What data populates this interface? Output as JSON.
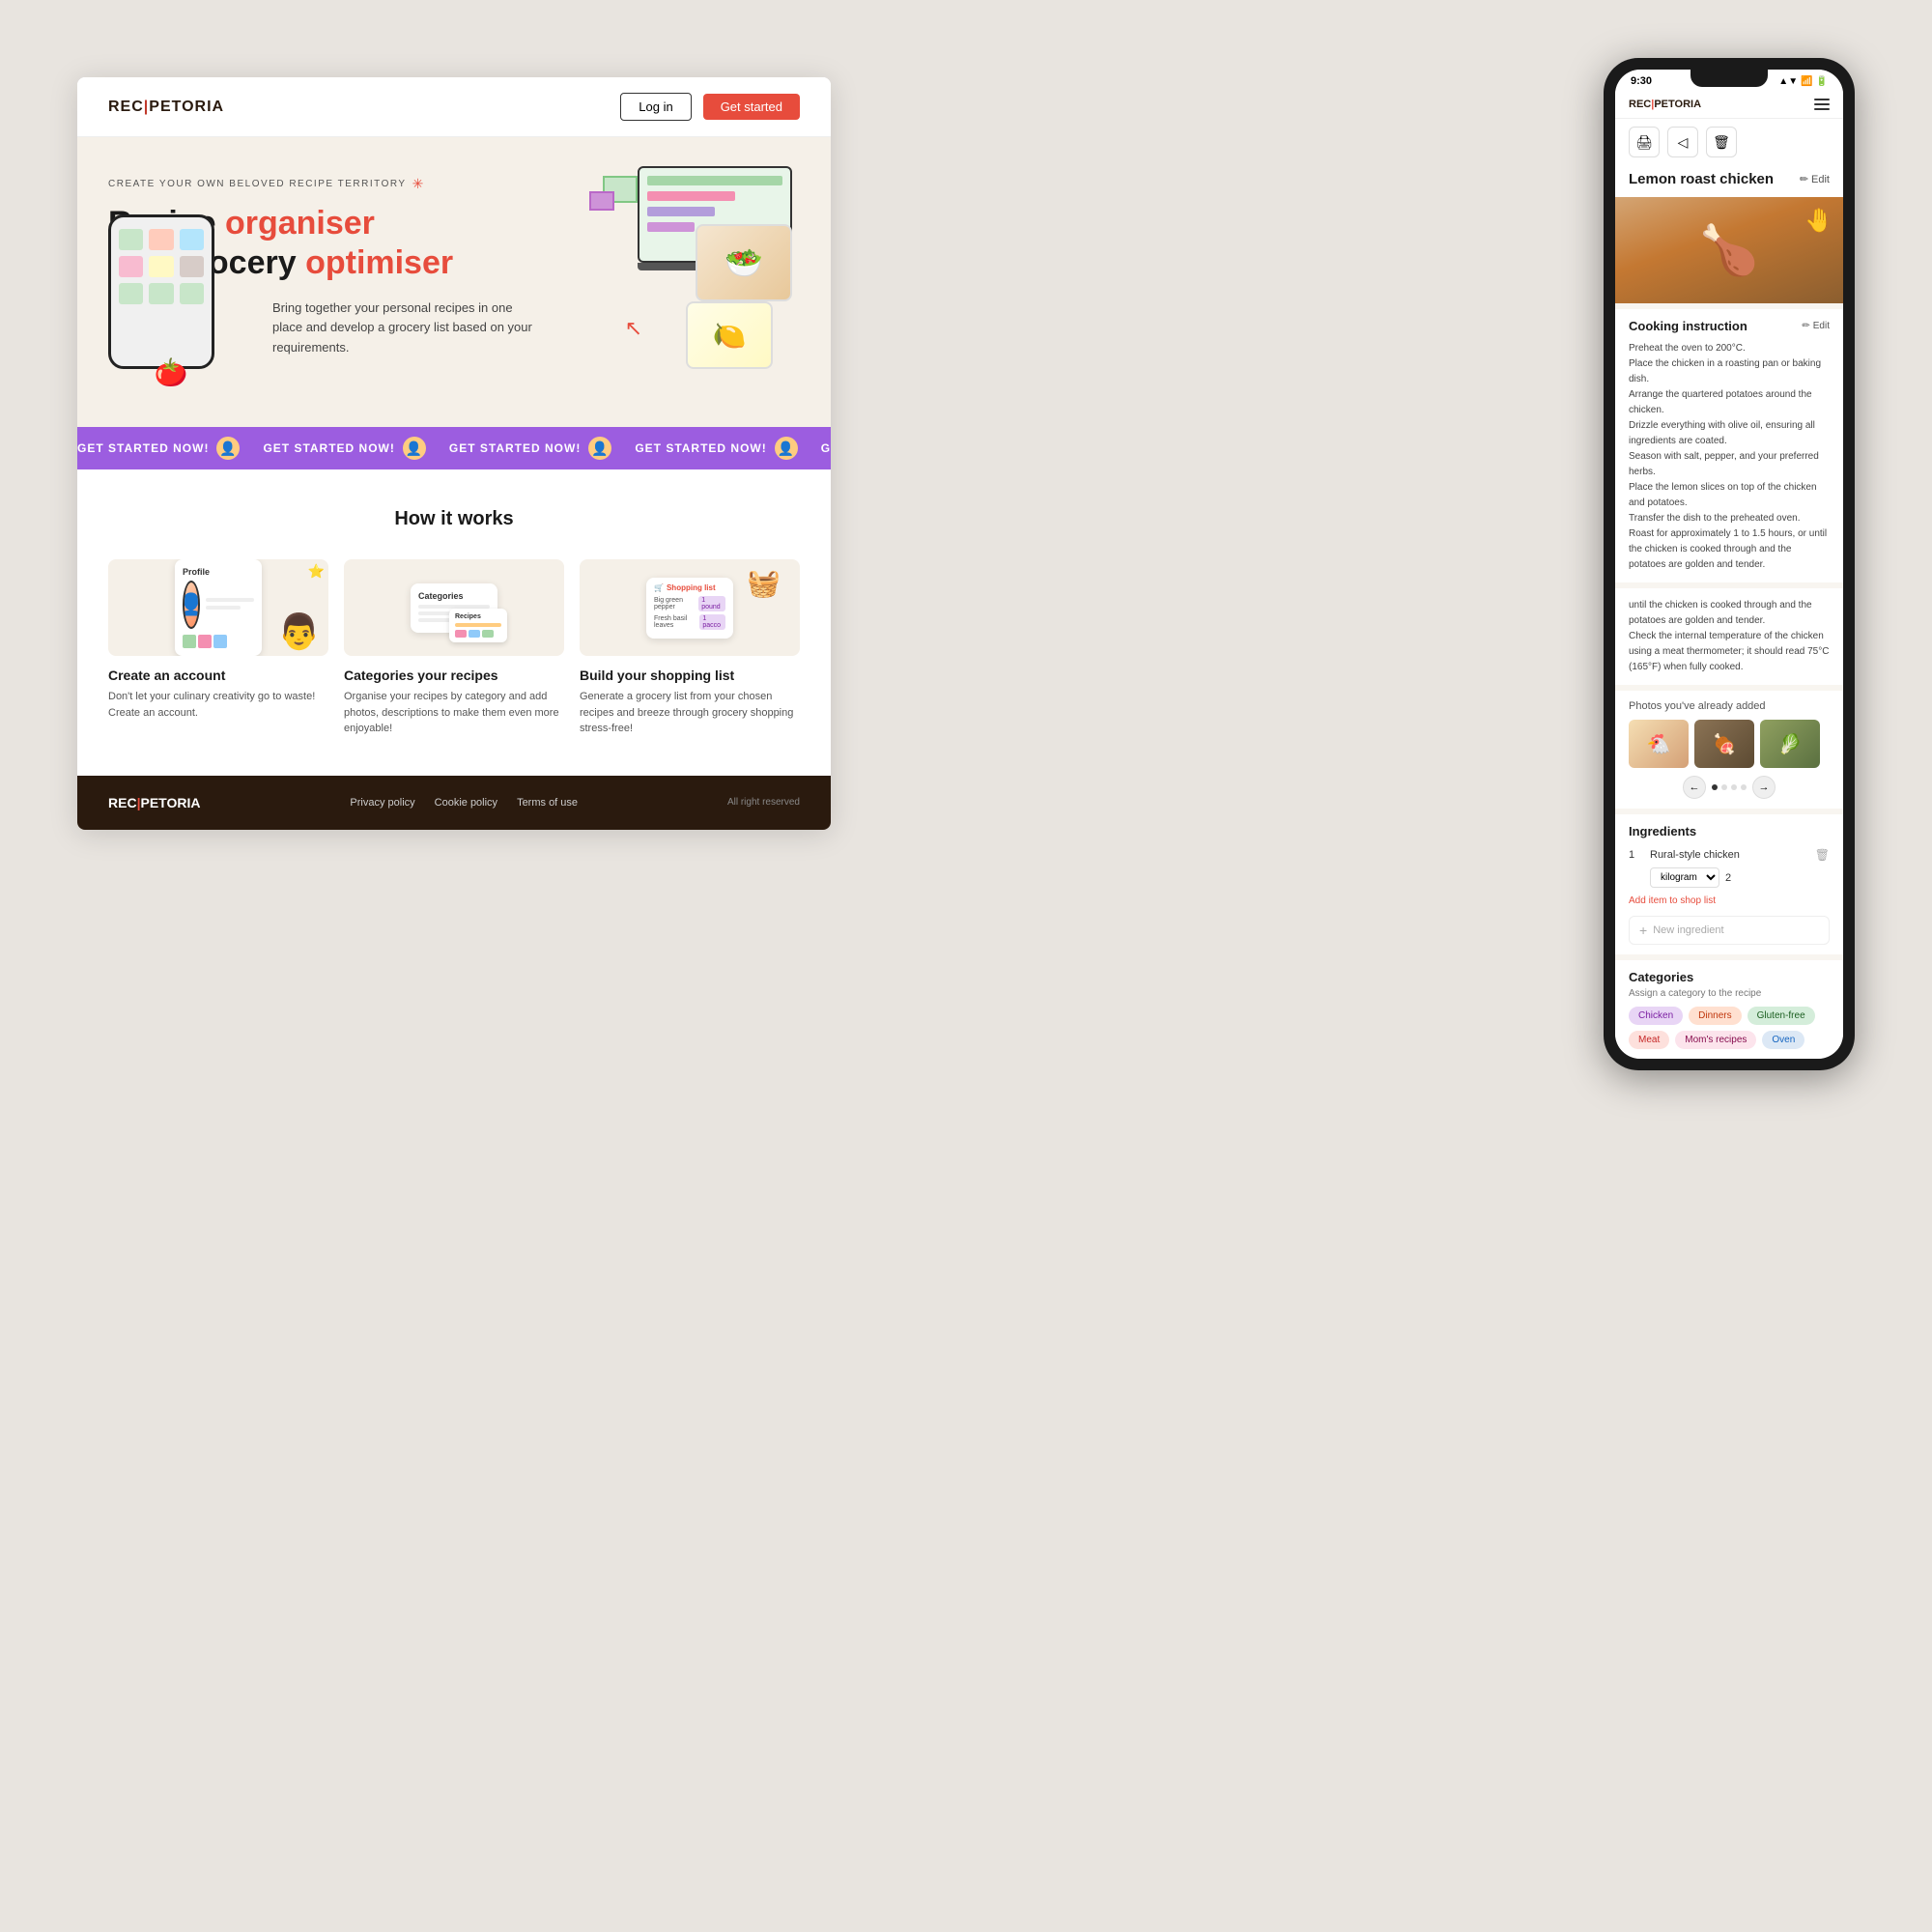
{
  "website": {
    "logo": "REC|PETORIA",
    "logo_part1": "REC",
    "logo_sep": "|",
    "logo_part2": "PETORIA",
    "nav": {
      "login_label": "Log in",
      "get_started_label": "Get started"
    },
    "hero": {
      "tag": "CREATE YOUR OWN BELOVED RECIPE TERRITORY",
      "title_line1": "Recipe ",
      "title_orange1": "organiser",
      "title_line2": "and grocery ",
      "title_orange2": "optimiser",
      "description": "Bring together your personal recipes in one place and develop a grocery list based on your requirements."
    },
    "ticker": {
      "items": [
        "GET STARTED NOW!",
        "GET STARTED NOW!",
        "GET STARTED NOW!",
        "GET STARTED NOW!",
        "GET STARTED NOW!",
        "GET STARTED NOW!"
      ]
    },
    "how_it_works": {
      "title": "How it works",
      "steps": [
        {
          "title": "Create an account",
          "description": "Don't let your culinary creativity go to waste! Create an account.",
          "card_title": "Profile"
        },
        {
          "title": "Categories your recipes",
          "description": "Organise your recipes by category and add photos, descriptions to make them even more enjoyable!",
          "card_title": "Categories"
        },
        {
          "title": "Build your shopping list",
          "description": "Generate a grocery list from your chosen recipes and breeze through grocery shopping stress-free!",
          "card_title": "Shopping list"
        }
      ]
    },
    "footer": {
      "logo": "REC|PETORIA",
      "links": [
        "Privacy policy",
        "Cookie policy",
        "Terms of use"
      ],
      "rights": "All right reserved"
    }
  },
  "phone": {
    "status_bar": {
      "time": "9:30",
      "signal": "▲▼",
      "battery": "█"
    },
    "app_logo": "REC|PETORIA",
    "recipe": {
      "title": "Lemon roast chicken",
      "edit_label": "Edit",
      "cooking_instruction_title": "Cooking instruction",
      "cooking_instruction_edit": "Edit",
      "cooking_steps": [
        "Preheat the oven to 200°C.",
        "Place the chicken in a roasting pan or baking dish.",
        "Arrange the quartered potatoes around the chicken.",
        "Drizzle everything with olive oil, ensuring all ingredients are coated.",
        "Season with salt, pepper, and your preferred herbs.",
        "Place the lemon slices on top of the chicken and potatoes.",
        "Transfer the dish to the preheated oven.",
        "Roast for approximately 1 to 1.5 hours, or until the chicken is cooked through and the potatoes are golden and tender.",
        "until the chicken is cooked through and the potatoes are golden and tender.",
        "Check the internal temperature of the chicken using a meat thermometer; it should read 75°C (165°F) when fully cooked."
      ],
      "photos_label": "Photos you've already added",
      "ingredients": {
        "title": "Ingredients",
        "items": [
          {
            "num": "1",
            "name": "Rural-style chicken",
            "unit": "kilogram",
            "qty": "2"
          }
        ],
        "add_to_shop": "Add item to shop list",
        "new_ingredient_placeholder": "New ingredient"
      },
      "categories": {
        "title": "Categories",
        "subtitle": "Assign a category to the recipe",
        "tags": [
          {
            "label": "Chicken",
            "style": "purple"
          },
          {
            "label": "Dinners",
            "style": "orange"
          },
          {
            "label": "Gluten-free",
            "style": "green"
          },
          {
            "label": "Meat",
            "style": "red"
          },
          {
            "label": "Mom's recipes",
            "style": "pink"
          },
          {
            "label": "Oven",
            "style": "blue"
          }
        ]
      },
      "action_buttons": [
        "🖨",
        "◁",
        "🗑"
      ]
    }
  }
}
